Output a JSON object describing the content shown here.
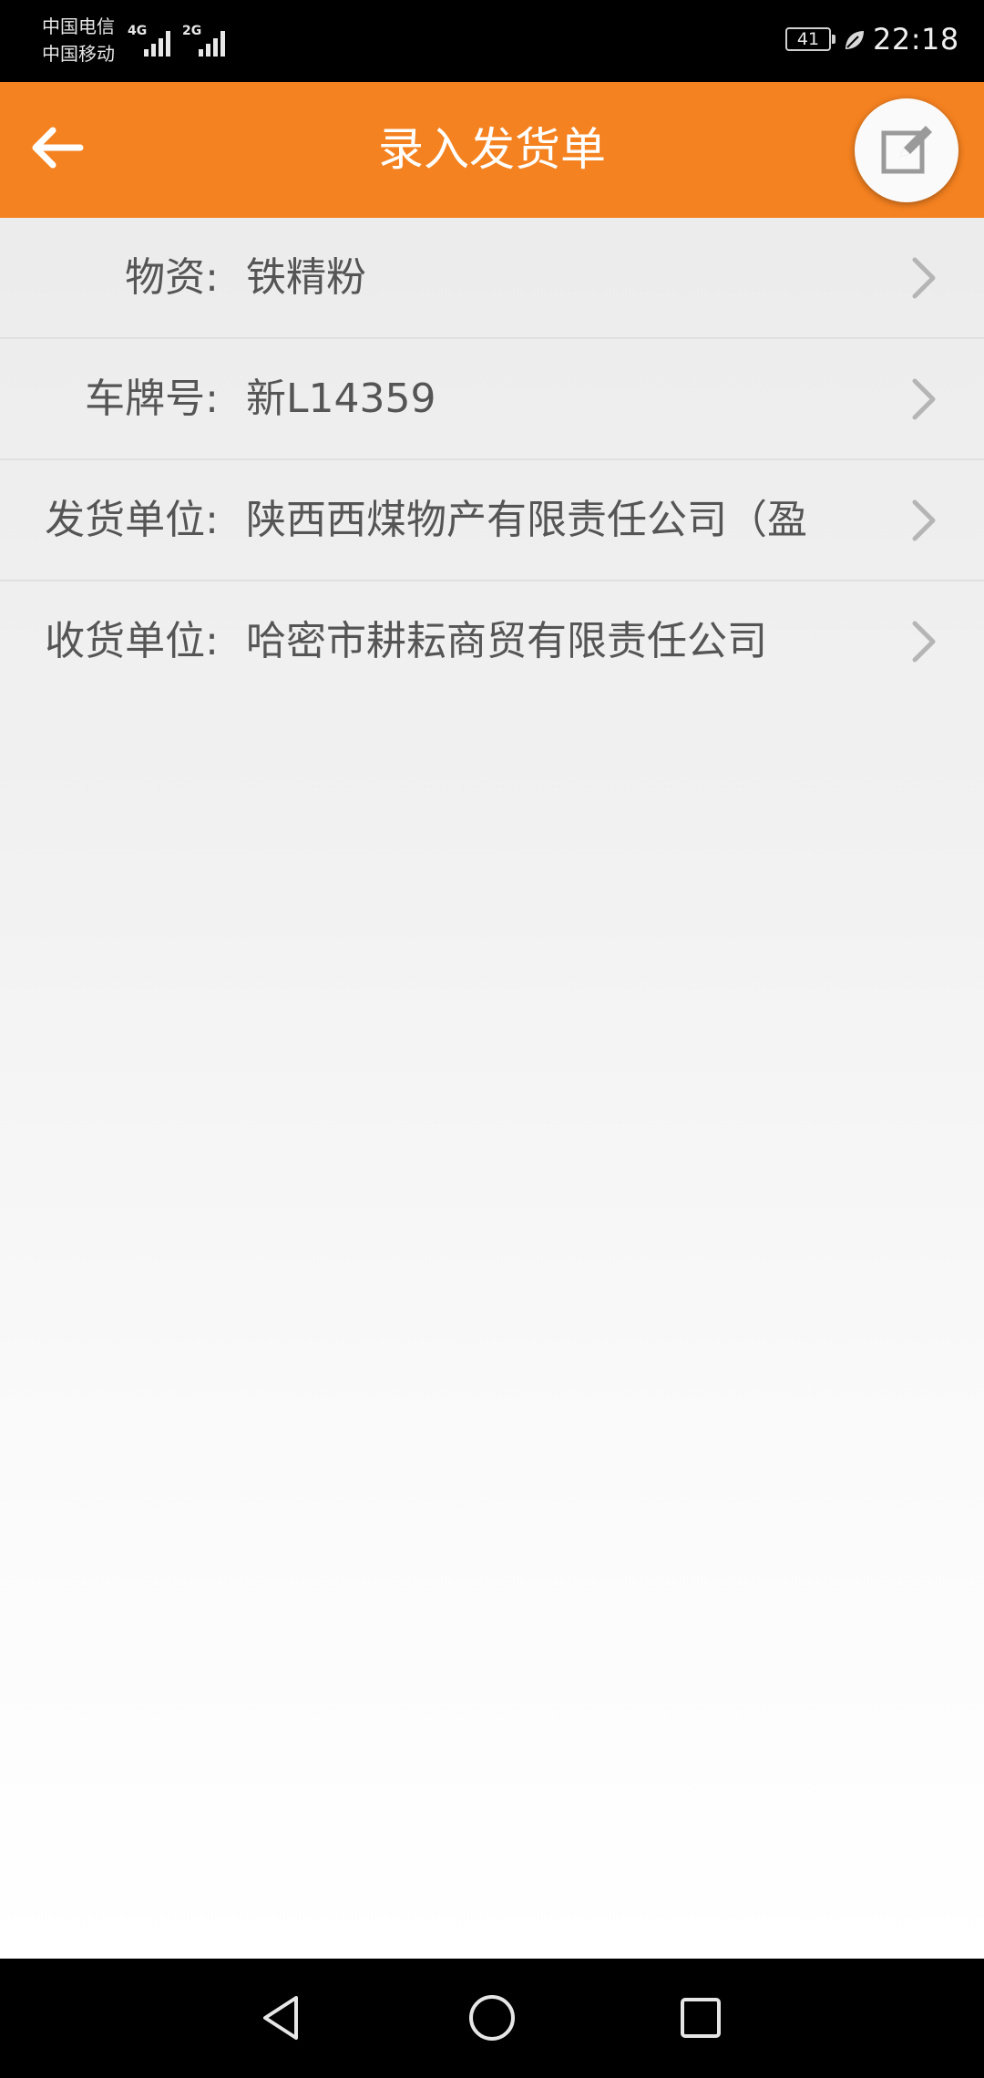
{
  "status_bar": {
    "carrier_1": "中国电信",
    "carrier_2": "中国移动",
    "network_1": "4G",
    "network_2": "2G",
    "battery_level": "41",
    "time": "22:18"
  },
  "header": {
    "title": "录入发货单",
    "back_icon": "arrow-left-icon",
    "edit_icon": "edit-icon",
    "accent_color": "#f58220"
  },
  "form": {
    "rows": [
      {
        "label": "物资:",
        "value": "铁精粉"
      },
      {
        "label": "车牌号:",
        "value": "新L14359"
      },
      {
        "label": "发货单位:",
        "value": "陕西西煤物产有限责任公司（盈"
      },
      {
        "label": "收货单位:",
        "value": "哈密市耕耘商贸有限责任公司"
      }
    ]
  },
  "nav_bar": {
    "back_icon": "triangle-back-icon",
    "home_icon": "circle-home-icon",
    "recent_icon": "square-recent-icon"
  }
}
